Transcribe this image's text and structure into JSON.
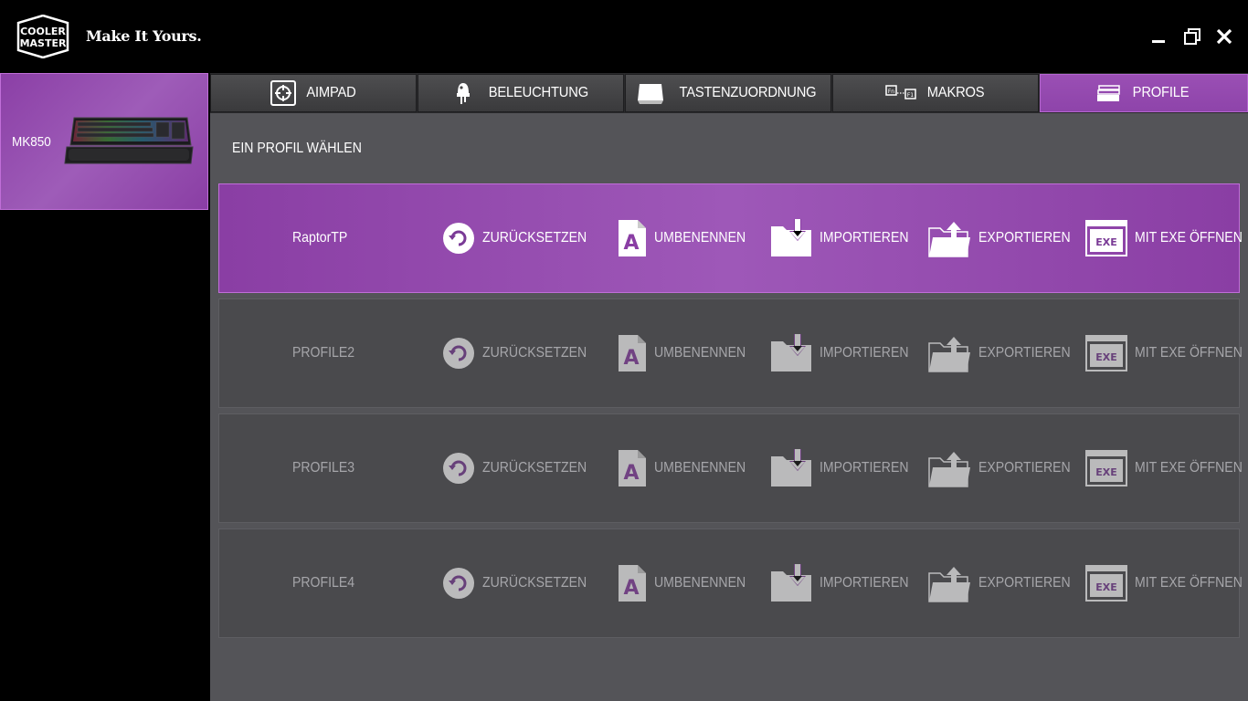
{
  "header": {
    "brand_logo_text": "COOLER MASTER",
    "tagline": "Make It Yours."
  },
  "device": {
    "name": "MK850",
    "image": "keyboard-image"
  },
  "tabs": [
    {
      "label": "AIMPAD",
      "icon": "aimpad-icon",
      "active": false
    },
    {
      "label": "BELEUCHTUNG",
      "icon": "lighting-icon",
      "active": false
    },
    {
      "label": "TASTENZUORDNUNG",
      "icon": "keymap-icon",
      "active": false
    },
    {
      "label": "MAKROS",
      "icon": "macro-icon",
      "active": false
    },
    {
      "label": "PROFILE",
      "icon": "profile-icon",
      "active": true
    }
  ],
  "section_title": "EIN PROFIL WÄHLEN",
  "actions": {
    "reset": "ZURÜCKSETZEN",
    "rename": "UMBENENNEN",
    "import": "IMPORTIEREN",
    "export": "EXPORTIEREN",
    "open_exe": "MIT EXE ÖFFNEN",
    "exe_badge": "EXE"
  },
  "profiles": [
    {
      "name": "RaptorTP",
      "active": true
    },
    {
      "name": "PROFILE2",
      "active": false
    },
    {
      "name": "PROFILE3",
      "active": false
    },
    {
      "name": "PROFILE4",
      "active": false
    }
  ],
  "colors": {
    "accent": "#9b51b6",
    "accent_border": "#c06ed8",
    "panel": "#545458",
    "row_inactive": "#4a4a4d",
    "text_inactive": "#a6a6aa"
  }
}
